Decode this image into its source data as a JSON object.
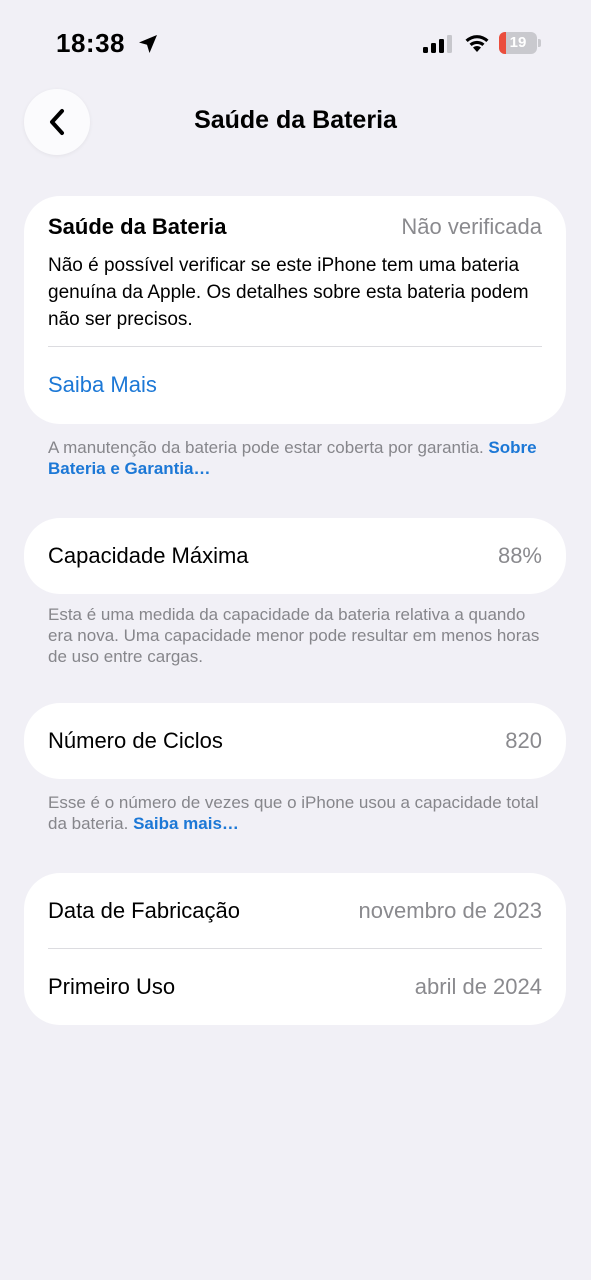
{
  "status_bar": {
    "time": "18:38",
    "battery_level": "19",
    "battery_fraction": 0.19,
    "battery_color": "#eb4e3d",
    "icons": [
      "location-arrow-icon",
      "cellular-signal-icon",
      "wifi-icon",
      "battery-icon"
    ]
  },
  "nav": {
    "back_icon": "chevron-left-icon",
    "title": "Saúde da Bateria"
  },
  "health_card": {
    "label": "Saúde da Bateria",
    "value": "Não verificada",
    "description": "Não é possível verificar se este iPhone tem uma bateria genuína da Apple. Os detalhes sobre esta bateria podem não ser precisos.",
    "learn_more": "Saiba Mais"
  },
  "health_footnote": {
    "text": "A manutenção da bateria pode estar coberta por garantia.",
    "link": "Sobre Bateria e Garantia…"
  },
  "capacity": {
    "label": "Capacidade Máxima",
    "value": "88%",
    "footnote": "Esta é uma medida da capacidade da bateria relativa a quando era nova. Uma capacidade menor pode resultar em menos horas de uso entre cargas."
  },
  "cycles": {
    "label": "Número de Ciclos",
    "value": "820",
    "footnote_text": "Esse é o número de vezes que o iPhone usou a capacidade total da bateria.",
    "footnote_link": "Saiba mais…"
  },
  "dates": {
    "manufacture_label": "Data de Fabricação",
    "manufacture_value": "novembro de 2023",
    "first_use_label": "Primeiro Uso",
    "first_use_value": "abril de 2024"
  },
  "colors": {
    "background": "#f1f0f6",
    "card": "#ffffff",
    "link": "#1c78d6",
    "secondary_text": "#8a8a8e"
  }
}
